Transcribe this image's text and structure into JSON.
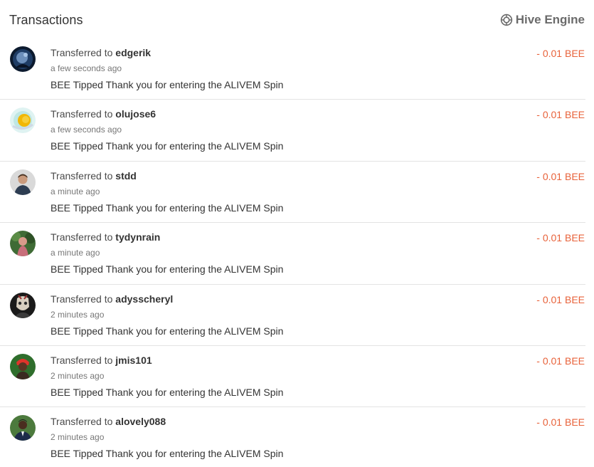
{
  "header": {
    "title": "Transactions",
    "engine_label": "Hive Engine",
    "engine_icon": "hive-engine-icon"
  },
  "colors": {
    "amount": "#e8623a",
    "divider": "#e3e3e3"
  },
  "transactions": [
    {
      "prefix": "Transferred to",
      "user": "edgerik",
      "time": "a few seconds ago",
      "memo": "BEE Tipped Thank you for entering the ALIVEM Spin",
      "amount": "- 0.01 BEE"
    },
    {
      "prefix": "Transferred to",
      "user": "olujose6",
      "time": "a few seconds ago",
      "memo": "BEE Tipped Thank you for entering the ALIVEM Spin",
      "amount": "- 0.01 BEE"
    },
    {
      "prefix": "Transferred to",
      "user": "stdd",
      "time": "a minute ago",
      "memo": "BEE Tipped Thank you for entering the ALIVEM Spin",
      "amount": "- 0.01 BEE"
    },
    {
      "prefix": "Transferred to",
      "user": "tydynrain",
      "time": "a minute ago",
      "memo": "BEE Tipped Thank you for entering the ALIVEM Spin",
      "amount": "- 0.01 BEE"
    },
    {
      "prefix": "Transferred to",
      "user": "adysscheryl",
      "time": "2 minutes ago",
      "memo": "BEE Tipped Thank you for entering the ALIVEM Spin",
      "amount": "- 0.01 BEE"
    },
    {
      "prefix": "Transferred to",
      "user": "jmis101",
      "time": "2 minutes ago",
      "memo": "BEE Tipped Thank you for entering the ALIVEM Spin",
      "amount": "- 0.01 BEE"
    },
    {
      "prefix": "Transferred to",
      "user": "alovely088",
      "time": "2 minutes ago",
      "memo": "BEE Tipped Thank you for entering the ALIVEM Spin",
      "amount": "- 0.01 BEE"
    }
  ]
}
